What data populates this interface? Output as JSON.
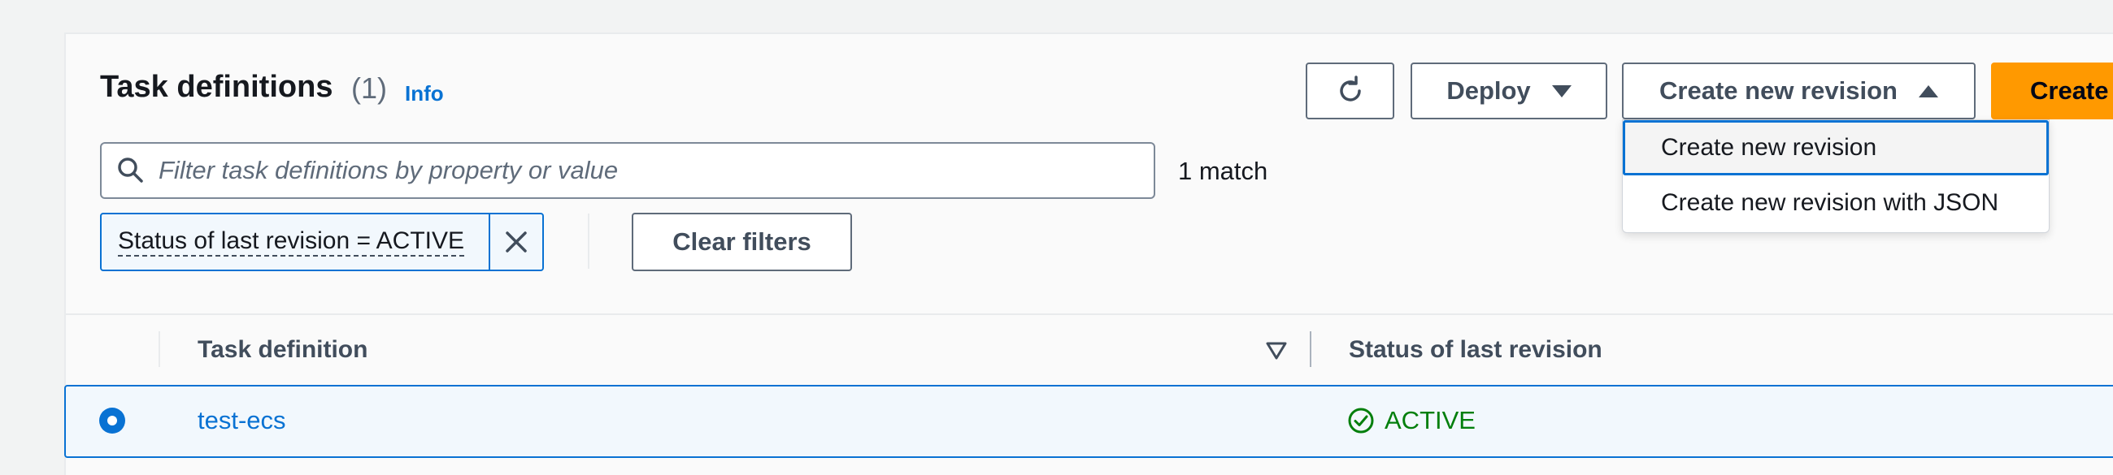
{
  "header": {
    "title": "Task definitions",
    "count": "(1)",
    "info_link": "Info"
  },
  "actions": {
    "refresh_icon": "refresh-icon",
    "deploy_label": "Deploy",
    "create_revision_label": "Create new revision",
    "create_label": "Create"
  },
  "revision_menu": {
    "expanded": true,
    "items": [
      {
        "label": "Create new revision"
      },
      {
        "label": "Create new revision with JSON"
      }
    ]
  },
  "filter": {
    "placeholder": "Filter task definitions by property or value",
    "value": "",
    "match_text": "1 match",
    "tokens": [
      {
        "label": "Status of last revision = ACTIVE"
      }
    ],
    "clear_label": "Clear filters"
  },
  "table": {
    "columns": [
      "Task definition",
      "Status of last revision"
    ],
    "rows": [
      {
        "selected": true,
        "task_definition": "test-ecs",
        "status": "ACTIVE"
      }
    ]
  },
  "colors": {
    "primary": "#0972d3",
    "create_button": "#ff9900",
    "status_active": "#037f0c",
    "page_bg": "#f2f3f3"
  }
}
